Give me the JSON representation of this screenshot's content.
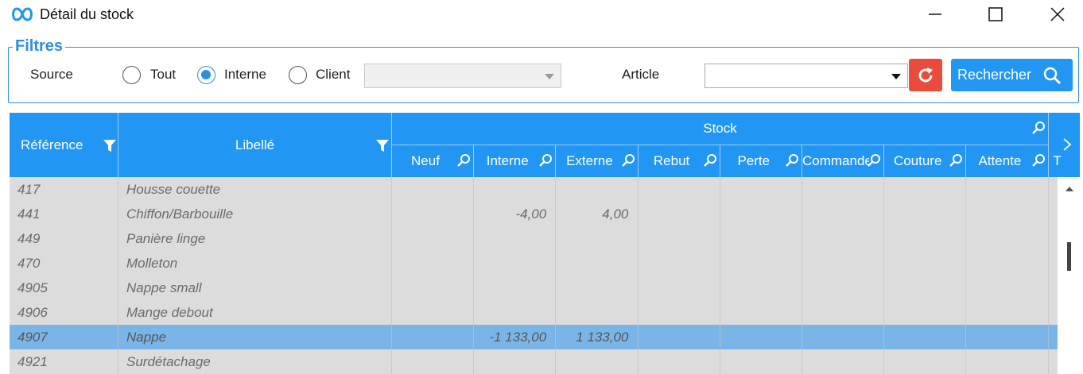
{
  "window": {
    "title": "Détail du stock",
    "icons": [
      "app-infinity-icon",
      "minimize-icon",
      "maximize-icon",
      "close-icon"
    ]
  },
  "filters": {
    "legend": "Filtres",
    "source_label": "Source",
    "radios": [
      {
        "label": "Tout",
        "checked": false
      },
      {
        "label": "Interne",
        "checked": true
      },
      {
        "label": "Client",
        "checked": false
      }
    ],
    "client_value": "",
    "article_label": "Article",
    "article_value": "",
    "reset_icon": "refresh-icon",
    "search_label": "Rechercher",
    "search_icon": "search-icon"
  },
  "colors": {
    "accent": "#2196f3",
    "reset": "#e94b3c",
    "selected_row": "#7ab5e8",
    "body": "#dcdcdc"
  },
  "grid": {
    "columns": {
      "reference": "Référence",
      "libelle": "Libellé",
      "stock_group": "Stock",
      "stock_cols": [
        "Neuf",
        "Interne",
        "Externe",
        "Rebut",
        "Perte",
        "Commande",
        "Couture",
        "Attente",
        "T"
      ]
    },
    "rows": [
      {
        "ref": "417",
        "label": "Housse couette",
        "interne": "",
        "externe": "",
        "selected": false
      },
      {
        "ref": "441",
        "label": "Chiffon/Barbouille",
        "interne": "-4,00",
        "externe": "4,00",
        "selected": false
      },
      {
        "ref": "449",
        "label": "Panière linge",
        "interne": "",
        "externe": "",
        "selected": false
      },
      {
        "ref": "470",
        "label": "Molleton",
        "interne": "",
        "externe": "",
        "selected": false
      },
      {
        "ref": "4905",
        "label": "Nappe small",
        "interne": "",
        "externe": "",
        "selected": false
      },
      {
        "ref": "4906",
        "label": "Mange debout",
        "interne": "",
        "externe": "",
        "selected": false
      },
      {
        "ref": "4907",
        "label": "Nappe",
        "interne": "-1 133,00",
        "externe": "1 133,00",
        "selected": true
      },
      {
        "ref": "4921",
        "label": "Surdétachage",
        "interne": "",
        "externe": "",
        "selected": false
      }
    ]
  }
}
